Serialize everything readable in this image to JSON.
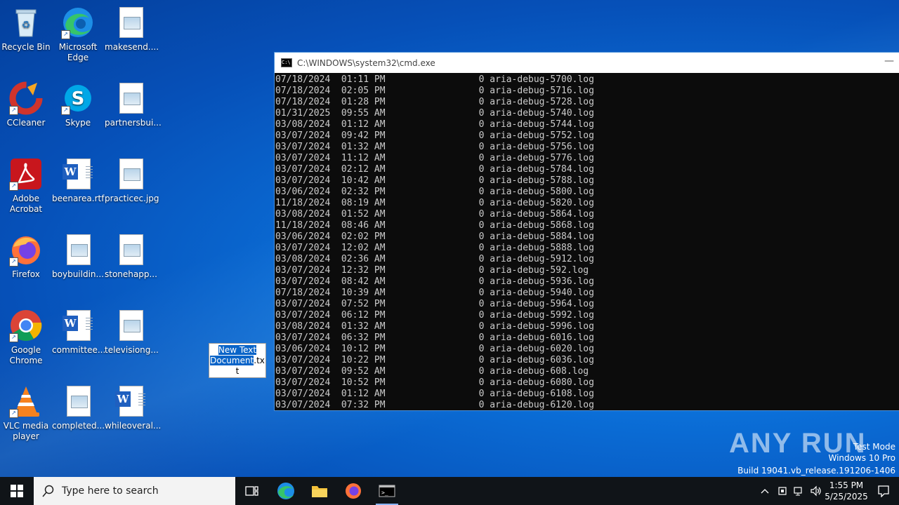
{
  "desktop": {
    "icons": [
      {
        "label": "Recycle Bin"
      },
      {
        "label": "Microsoft Edge"
      },
      {
        "label": "makesend...."
      },
      {
        "label": "CCleaner"
      },
      {
        "label": "Skype"
      },
      {
        "label": "partnersbui..."
      },
      {
        "label": "Adobe Acrobat"
      },
      {
        "label": "beenarea.rtf"
      },
      {
        "label": "practicec.jpg"
      },
      {
        "label": "Firefox"
      },
      {
        "label": "boybuildin..."
      },
      {
        "label": "stonehapp..."
      },
      {
        "label": "Google Chrome"
      },
      {
        "label": "committee..."
      },
      {
        "label": "televisiong..."
      },
      {
        "label": "VLC media player"
      },
      {
        "label": "completed..."
      },
      {
        "label": "whileoveral..."
      }
    ],
    "rename_box": {
      "selected_text": "New Text Document",
      "rest_text": ".tx",
      "line2": "t"
    }
  },
  "cmd_window": {
    "title": "C:\\WINDOWS\\system32\\cmd.exe",
    "minimize_label": "—",
    "lines": [
      "07/18/2024  01:11 PM                 0 aria-debug-5700.log",
      "07/18/2024  02:05 PM                 0 aria-debug-5716.log",
      "07/18/2024  01:28 PM                 0 aria-debug-5728.log",
      "01/31/2025  09:55 AM                 0 aria-debug-5740.log",
      "03/08/2024  01:12 AM                 0 aria-debug-5744.log",
      "03/07/2024  09:42 PM                 0 aria-debug-5752.log",
      "03/07/2024  01:32 AM                 0 aria-debug-5756.log",
      "03/07/2024  11:12 AM                 0 aria-debug-5776.log",
      "03/07/2024  02:12 AM                 0 aria-debug-5784.log",
      "03/07/2024  10:42 AM                 0 aria-debug-5788.log",
      "03/06/2024  02:32 PM                 0 aria-debug-5800.log",
      "11/18/2024  08:19 AM                 0 aria-debug-5820.log",
      "03/08/2024  01:52 AM                 0 aria-debug-5864.log",
      "11/18/2024  08:46 AM                 0 aria-debug-5868.log",
      "03/06/2024  02:02 PM                 0 aria-debug-5884.log",
      "03/07/2024  12:02 AM                 0 aria-debug-5888.log",
      "03/08/2024  02:36 AM                 0 aria-debug-5912.log",
      "03/07/2024  12:32 PM                 0 aria-debug-592.log",
      "03/07/2024  08:42 AM                 0 aria-debug-5936.log",
      "07/18/2024  10:39 AM                 0 aria-debug-5940.log",
      "03/07/2024  07:52 PM                 0 aria-debug-5964.log",
      "03/07/2024  06:12 PM                 0 aria-debug-5992.log",
      "03/08/2024  01:32 AM                 0 aria-debug-5996.log",
      "03/07/2024  06:32 PM                 0 aria-debug-6016.log",
      "03/06/2024  10:12 PM                 0 aria-debug-6020.log",
      "03/07/2024  10:22 PM                 0 aria-debug-6036.log",
      "03/07/2024  09:52 AM                 0 aria-debug-608.log",
      "03/07/2024  10:52 PM                 0 aria-debug-6080.log",
      "03/07/2024  01:12 AM                 0 aria-debug-6108.log",
      "03/07/2024  07:32 PM                 0 aria-debug-6120.log"
    ]
  },
  "watermark": {
    "brand": "ANY RUN",
    "line1": "Test Mode",
    "line2": "Windows 10 Pro",
    "line3": "Build 19041.vb_release.191206-1406"
  },
  "taskbar": {
    "search_placeholder": "Type here to search",
    "time": "1:55 PM",
    "date": "5/25/2025"
  }
}
